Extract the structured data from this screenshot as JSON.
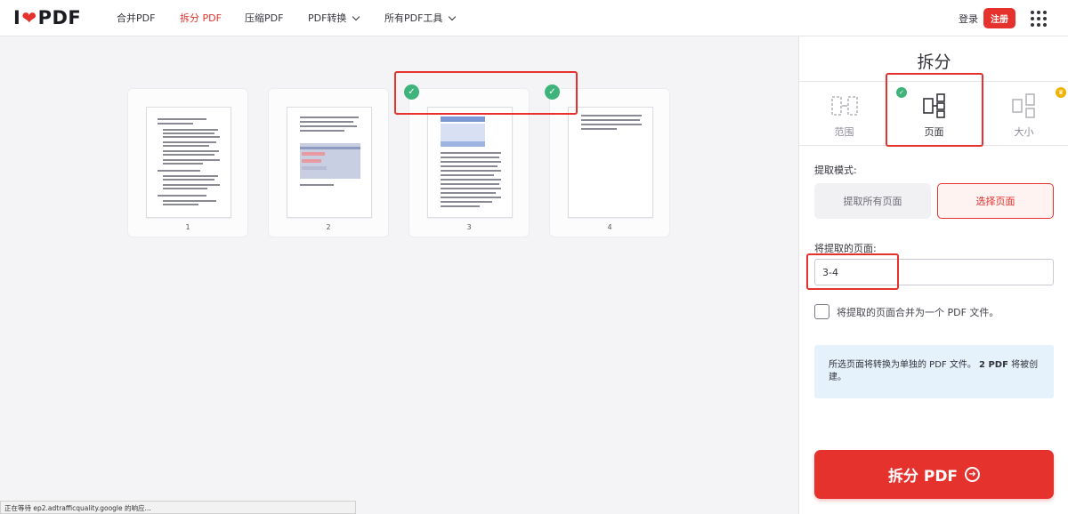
{
  "logo": {
    "left": "I",
    "heart": "❤",
    "right": "PDF"
  },
  "nav": {
    "items": [
      {
        "label": "合并PDF",
        "active": false,
        "dropdown": false
      },
      {
        "label": "拆分 PDF",
        "active": true,
        "dropdown": false
      },
      {
        "label": "压缩PDF",
        "active": false,
        "dropdown": false
      },
      {
        "label": "PDF转换",
        "active": false,
        "dropdown": true
      },
      {
        "label": "所有PDF工具",
        "active": false,
        "dropdown": true
      }
    ],
    "login": "登录",
    "signup": "注册"
  },
  "pages": [
    {
      "number": "1",
      "selected": false
    },
    {
      "number": "2",
      "selected": false
    },
    {
      "number": "3",
      "selected": true
    },
    {
      "number": "4",
      "selected": true
    }
  ],
  "status_bar": "正在等待 ep2.adtrafficquality.google 的响应...",
  "panel": {
    "title": "拆分",
    "modes": [
      {
        "label": "范围",
        "icon": "range-icon",
        "active": false
      },
      {
        "label": "页面",
        "icon": "pages-icon",
        "active": true
      },
      {
        "label": "大小",
        "icon": "size-icon",
        "active": false,
        "premium": true
      }
    ],
    "extract_mode_label": "提取模式:",
    "extract_all_label": "提取所有页面",
    "select_pages_label": "选择页面",
    "pages_to_extract_label": "将提取的页面:",
    "pages_value": "3-4",
    "merge_label": "将提取的页面合并为一个 PDF 文件。",
    "info_prefix": "所选页面将转换为单独的 PDF 文件。",
    "info_bold": "2 PDF",
    "info_suffix": "将被创建。",
    "split_button": "拆分 PDF"
  },
  "colors": {
    "accent": "#e5322d",
    "check": "#3fb47a",
    "info_bg": "#e5f2fc"
  }
}
